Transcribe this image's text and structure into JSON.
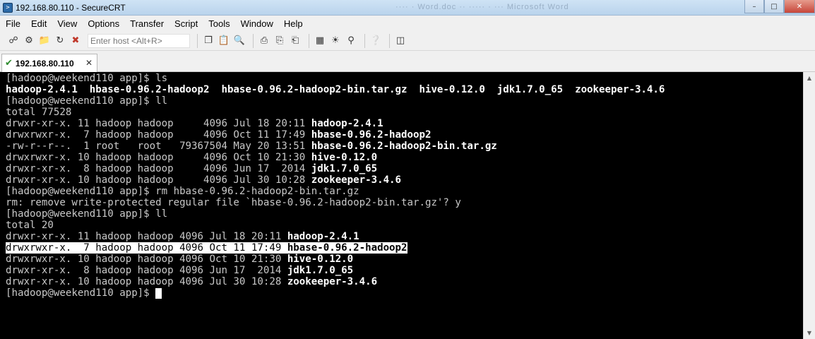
{
  "window": {
    "title": "192.168.80.110 - SecureCRT",
    "ghost_title": "···· · Word.doc ·· ····· · ··· Microsoft Word"
  },
  "menu": [
    "File",
    "Edit",
    "View",
    "Options",
    "Transfer",
    "Script",
    "Tools",
    "Window",
    "Help"
  ],
  "toolbar": {
    "host_placeholder": "Enter host <Alt+R>"
  },
  "tab": {
    "label": "192.168.80.110"
  },
  "terminal": {
    "lines": [
      [
        {
          "t": "[hadoop@weekend110 app]$ ls"
        }
      ],
      [
        {
          "t": "hadoop-2.4.1  hbase-0.96.2-hadoop2  hbase-0.96.2-hadoop2-bin.tar.gz  hive-0.12.0  jdk1.7.0_65  zookeeper-3.4.6",
          "b": true
        }
      ],
      [
        {
          "t": "[hadoop@weekend110 app]$ ll"
        }
      ],
      [
        {
          "t": "total 77528"
        }
      ],
      [
        {
          "t": "drwxr-xr-x. 11 hadoop hadoop     4096 Jul 18 20:11 "
        },
        {
          "t": "hadoop-2.4.1",
          "b": true
        }
      ],
      [
        {
          "t": "drwxrwxr-x.  7 hadoop hadoop     4096 Oct 11 17:49 "
        },
        {
          "t": "hbase-0.96.2-hadoop2",
          "b": true
        }
      ],
      [
        {
          "t": "-rw-r--r--.  1 root   root   79367504 May 20 13:51 "
        },
        {
          "t": "hbase-0.96.2-hadoop2-bin.tar.gz",
          "b": true
        }
      ],
      [
        {
          "t": "drwxrwxr-x. 10 hadoop hadoop     4096 Oct 10 21:30 "
        },
        {
          "t": "hive-0.12.0",
          "b": true
        }
      ],
      [
        {
          "t": "drwxr-xr-x.  8 hadoop hadoop     4096 Jun 17  2014 "
        },
        {
          "t": "jdk1.7.0_65",
          "b": true
        }
      ],
      [
        {
          "t": "drwxr-xr-x. 10 hadoop hadoop     4096 Jul 30 10:28 "
        },
        {
          "t": "zookeeper-3.4.6",
          "b": true
        }
      ],
      [
        {
          "t": "[hadoop@weekend110 app]$ rm hbase-0.96.2-hadoop2-bin.tar.gz"
        }
      ],
      [
        {
          "t": "rm: remove write-protected regular file `hbase-0.96.2-hadoop2-bin.tar.gz'? y"
        }
      ],
      [
        {
          "t": "[hadoop@weekend110 app]$ ll"
        }
      ],
      [
        {
          "t": "total 20"
        }
      ],
      [
        {
          "t": "drwxr-xr-x. 11 hadoop hadoop 4096 Jul 18 20:11 "
        },
        {
          "t": "hadoop-2.4.1",
          "b": true
        }
      ],
      [
        {
          "t": "drwxrwxr-x.  7 hadoop hadoop 4096 Oct 11 17:49 ",
          "h": true
        },
        {
          "t": "hbase-0.96.2-hadoop2",
          "b": true,
          "h": true
        }
      ],
      [
        {
          "t": "drwxrwxr-x. 10 hadoop hadoop 4096 Oct 10 21:30 "
        },
        {
          "t": "hive-0.12.0",
          "b": true
        }
      ],
      [
        {
          "t": "drwxr-xr-x.  8 hadoop hadoop 4096 Jun 17  2014 "
        },
        {
          "t": "jdk1.7.0_65",
          "b": true
        }
      ],
      [
        {
          "t": "drwxr-xr-x. 10 hadoop hadoop 4096 Jul 30 10:28 "
        },
        {
          "t": "zookeeper-3.4.6",
          "b": true
        }
      ],
      [
        {
          "t": "[hadoop@weekend110 app]$ "
        },
        {
          "cursor": true
        }
      ]
    ]
  }
}
